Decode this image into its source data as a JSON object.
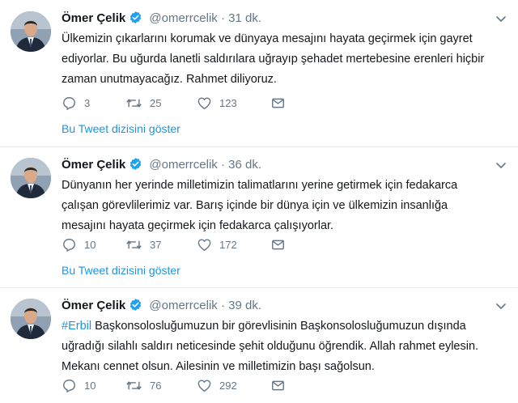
{
  "tweets": [
    {
      "name": "Ömer Çelik",
      "handle": "@omerrcelik",
      "dot": "·",
      "time": "31 dk.",
      "text_lines": [
        "Ülkemizin çıkarlarını korumak ve dünyaya mesajını hayata geçirmek için gayret",
        "ediyorlar. Bu uğurda lanetli saldırılara uğrayıp şehadet mertebesine erenleri hiçbir",
        "zaman unutmayacağız. Rahmet diliyoruz."
      ],
      "replies": "3",
      "retweets": "25",
      "likes": "123",
      "thread_link": "Bu Tweet dizisini göster"
    },
    {
      "name": "Ömer Çelik",
      "handle": "@omerrcelik",
      "dot": "·",
      "time": "36 dk.",
      "text_lines": [
        "Dünyanın her yerinde milletimizin talimatlarını yerine getirmek için fedakarca",
        "çalışan görevlilerimiz var. Barış içinde bir dünya için ve ülkemizin insanlığa",
        "mesajını hayata geçirmek için fedakarca çalışıyorlar."
      ],
      "replies": "10",
      "retweets": "37",
      "likes": "172",
      "thread_link": "Bu Tweet dizisini göster"
    },
    {
      "name": "Ömer Çelik",
      "handle": "@omerrcelik",
      "dot": "·",
      "time": "39 dk.",
      "hashtag": "#Erbil",
      "text_lines": [
        " Başkonsolosluğumuzun bir görevlisinin Başkonsolosluğumuzun dışında",
        "uğradığı silahlı saldırı neticesinde şehit olduğunu öğrendik. Allah rahmet eylesin.",
        "Mekanı cennet olsun. Ailesinin ve milletimizin başı sağolsun."
      ],
      "replies": "10",
      "retweets": "76",
      "likes": "292"
    }
  ],
  "colors": {
    "link": "#1b95e0",
    "verified": "#1da1f2",
    "muted": "#657786",
    "divider": "#e6ecf0"
  },
  "icons": [
    "reply-icon",
    "retweet-icon",
    "like-icon",
    "message-icon",
    "verified-badge-icon",
    "chevron-down-icon"
  ]
}
